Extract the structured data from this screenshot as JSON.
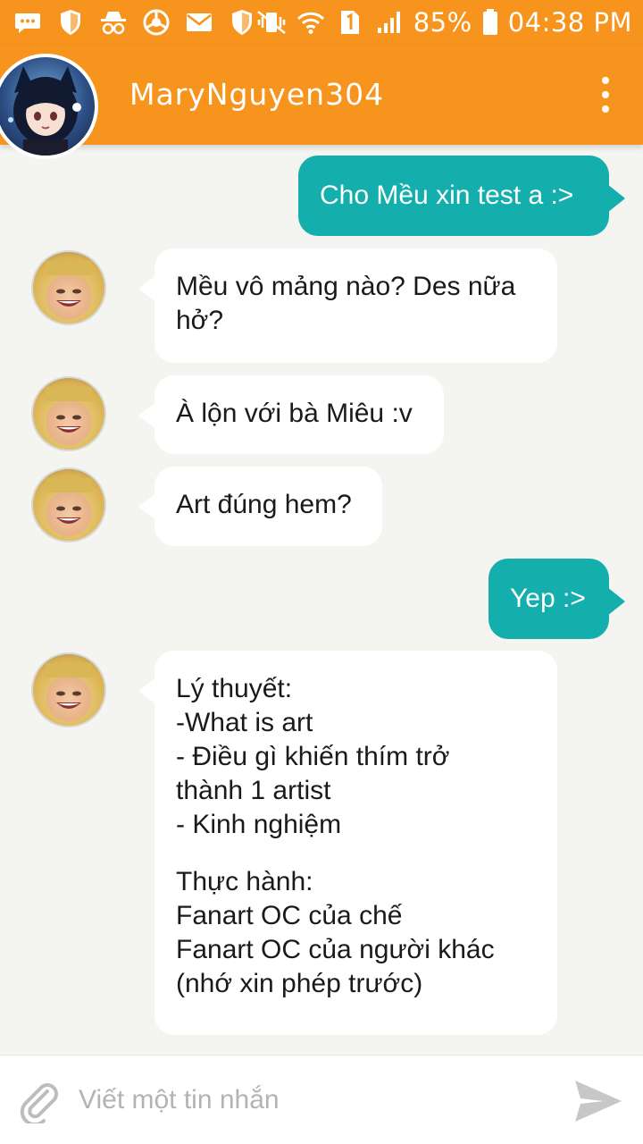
{
  "status_bar": {
    "battery": "85%",
    "time": "04:38 PM",
    "left_icons": [
      "message-icon",
      "shield-icon",
      "spy-icon",
      "browser-icon",
      "mail-icon",
      "shield-icon"
    ],
    "right_icons": [
      "vibrate-icon",
      "wifi-icon",
      "sim-1-icon",
      "signal-icon",
      "battery-icon"
    ]
  },
  "header": {
    "contact_name": "MaryNguyen304",
    "more_icon": "more-vertical-icon"
  },
  "messages": [
    {
      "direction": "out",
      "lines": [
        "Cho Mều xin test a :>"
      ]
    },
    {
      "direction": "in",
      "lines": [
        "Mều vô mảng nào? Des nữa",
        "hở?"
      ]
    },
    {
      "direction": "in",
      "lines": [
        "À lộn với bà Miêu :v"
      ]
    },
    {
      "direction": "in",
      "lines": [
        "Art đúng hem?"
      ]
    },
    {
      "direction": "out",
      "lines": [
        "Yep :>"
      ]
    },
    {
      "direction": "in",
      "lines": [
        "Lý thuyết:",
        "-What is art",
        "- Điều gì khiến thím trở",
        "thành 1 artist",
        "- Kinh nghiệm",
        "",
        "Thực hành:",
        "Fanart OC của chế",
        "Fanart OC của người khác",
        "(nhớ xin phép trước)"
      ]
    }
  ],
  "composer": {
    "placeholder": "Viết một tin nhắn",
    "value": "",
    "attach_icon": "paperclip-icon",
    "send_icon": "send-icon"
  },
  "colors": {
    "brand": "#f7941d",
    "outgoing_bubble": "#14aeac",
    "incoming_bubble": "#ffffff",
    "background": "#f4f4f0"
  }
}
